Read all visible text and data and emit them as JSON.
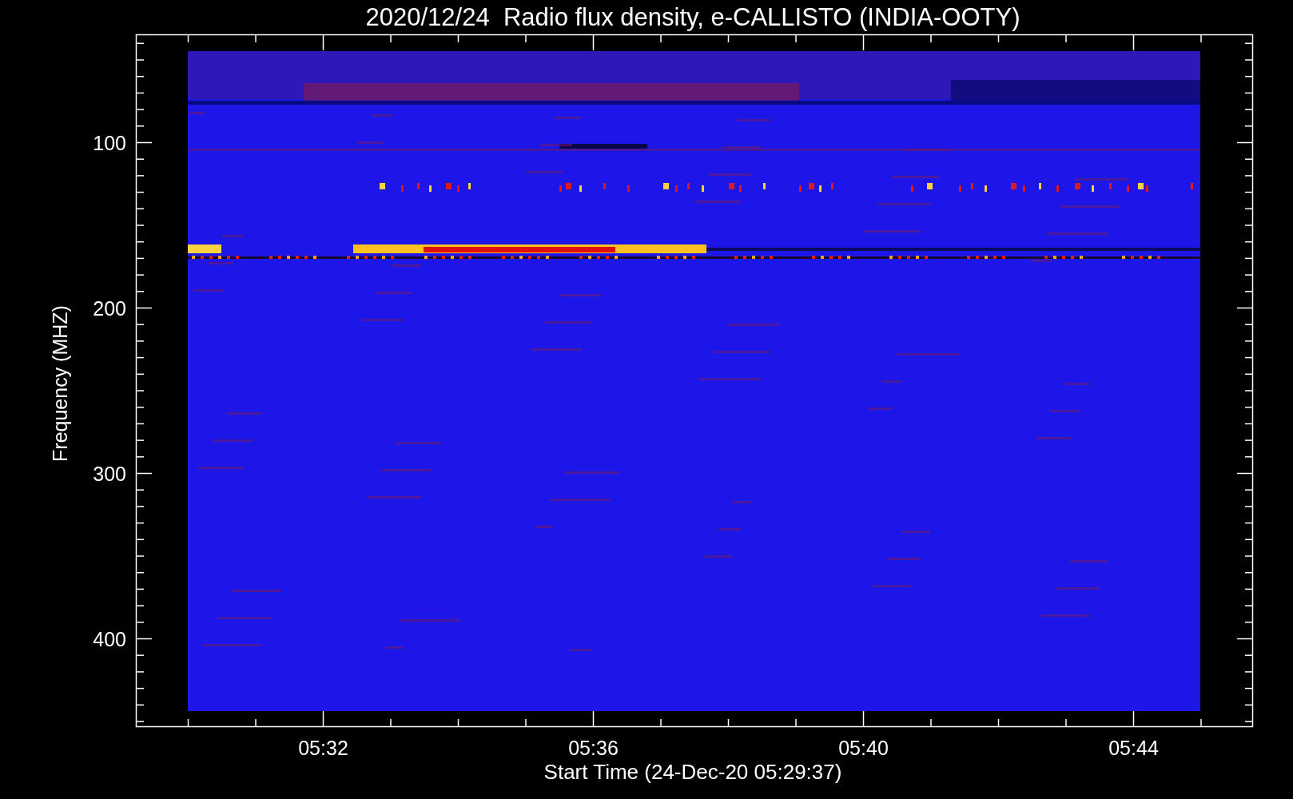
{
  "title": "2020/12/24  Radio flux density, e-CALLISTO (INDIA-OOTY)",
  "plot": {
    "ylabel": "Frequency (MHZ)",
    "xlabel": "Start Time (24-Dec-20 05:29:37)",
    "y_tick_labels": [
      "100",
      "200",
      "300",
      "400"
    ],
    "x_tick_labels": [
      "05:32",
      "05:36",
      "05:40",
      "05:44"
    ]
  }
}
